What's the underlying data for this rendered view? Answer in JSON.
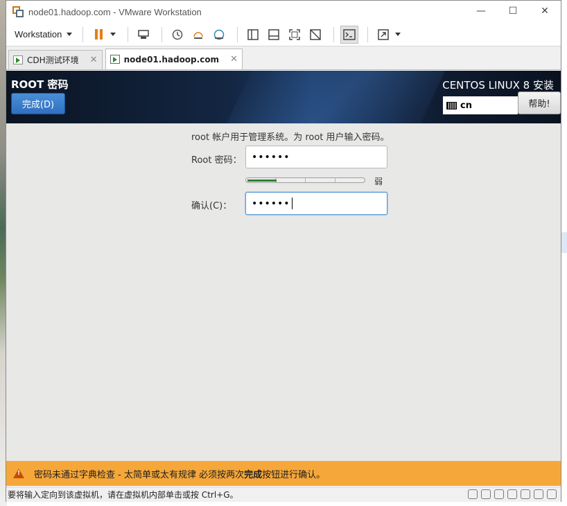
{
  "window": {
    "title": "node01.hadoop.com - VMware Workstation",
    "controls": {
      "minimize": "—",
      "maximize": "☐",
      "close": "✕"
    }
  },
  "toolbar": {
    "workstation_menu": "Workstation",
    "icons": [
      "pause-icon",
      "send-ctrl-alt-del-icon",
      "snapshot-icon",
      "revert-snapshot-icon",
      "snapshot-manager-icon",
      "library-icon",
      "thumbnail-icon",
      "fullscreen-icon",
      "unity-icon",
      "console-icon",
      "stretch-icon"
    ]
  },
  "tabs": [
    {
      "label": "CDH测试环境",
      "close": "✕",
      "active": false
    },
    {
      "label": "node01.hadoop.com",
      "close": "✕",
      "active": true
    }
  ],
  "installer": {
    "page_title": "ROOT 密码",
    "done_label": "完成(D)",
    "product": "CENTOS LINUX 8 安装",
    "keyboard_layout": "cn",
    "help_label": "帮助!",
    "description": "root 帐户用于管理系统。为 root 用户输入密码。",
    "root_label": "Root 密码：",
    "root_value": "••••••",
    "strength_label": "弱",
    "strength_fraction": 0.25,
    "confirm_label": "确认(C)：",
    "confirm_value": "••••••"
  },
  "warning": {
    "text_before": "密码未通过字典检查 - 太简单或太有规律 必须按两次",
    "text_bold": "完成",
    "text_after": "按钮进行确认。"
  },
  "statusbar": {
    "text": "要将输入定向到该虚拟机，请在虚拟机内部单击或按 Ctrl+G。"
  },
  "colors": {
    "accent_orange": "#e87d14",
    "warning_bar": "#f6a739",
    "done_button": "#2f6fc0",
    "strength_fill": "#2e7d32"
  }
}
